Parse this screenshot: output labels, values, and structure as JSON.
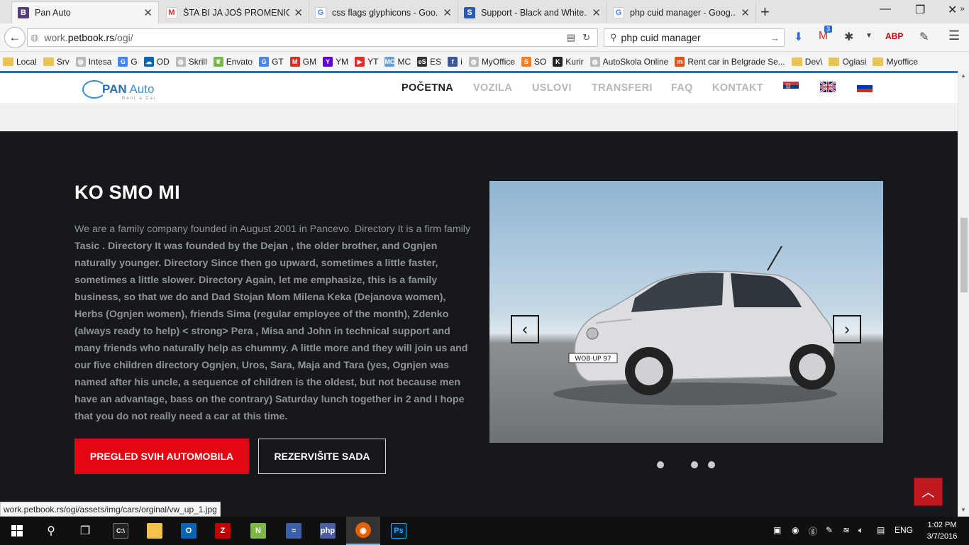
{
  "browser": {
    "tabs": [
      {
        "title": "Pan Auto",
        "favicon": "B",
        "favicon_color": "#563d7c",
        "active": true
      },
      {
        "title": "ŠTA BI JA JOŠ PROMENIO ...",
        "favicon": "M",
        "favicon_color": "#d93025",
        "active": false
      },
      {
        "title": "css flags glyphicons - Goo...",
        "favicon": "G",
        "favicon_color": "#4285f4",
        "active": false
      },
      {
        "title": "Support - Black and White...",
        "favicon": "S",
        "favicon_color": "#2a5bb0",
        "active": false
      },
      {
        "title": "php cuid manager - Goog...",
        "favicon": "G",
        "favicon_color": "#4285f4",
        "active": false
      }
    ],
    "new_tab": "+",
    "url_host": "work.",
    "url_domain": "petbook.rs",
    "url_path": "/ogi/",
    "search_value": "php cuid manager",
    "gmail_badge": "3",
    "bookmarks": [
      {
        "label": "Local",
        "icon": "folder"
      },
      {
        "label": "Srv",
        "icon": "folder"
      },
      {
        "label": "Intesa",
        "icon": "globe"
      },
      {
        "label": "G",
        "icon": "G"
      },
      {
        "label": "OD",
        "icon": "cloud"
      },
      {
        "label": "Skrill",
        "icon": "globe"
      },
      {
        "label": "Envato",
        "icon": "leaf"
      },
      {
        "label": "GT",
        "icon": "translate"
      },
      {
        "label": "GM",
        "icon": "M"
      },
      {
        "label": "YM",
        "icon": "Y"
      },
      {
        "label": "YT",
        "icon": "youtube"
      },
      {
        "label": "MC",
        "icon": "mc"
      },
      {
        "label": "ES",
        "icon": "es"
      },
      {
        "label": "i",
        "icon": "f"
      },
      {
        "label": "MyOffice",
        "icon": "globe"
      },
      {
        "label": "SO",
        "icon": "so"
      },
      {
        "label": "Kurir",
        "icon": "K"
      },
      {
        "label": "AutoSkola Online",
        "icon": "globe"
      },
      {
        "label": "Rent car in Belgrade Se...",
        "icon": "m"
      },
      {
        "label": "Dev\\",
        "icon": "folder"
      },
      {
        "label": "Oglasi",
        "icon": "folder"
      },
      {
        "label": "Myoffice",
        "icon": "folder"
      }
    ]
  },
  "site": {
    "logo_main": "PAN",
    "logo_accent": " Auto",
    "logo_sub": "Rent a Car",
    "menu": [
      "POČETNA",
      "VOZILA",
      "USLOVI",
      "TRANSFERI",
      "FAQ",
      "KONTAKT"
    ],
    "heading": "KO SMO MI",
    "paragraph_lead": "We are a family company founded in August 2001 in Pancevo. Directory It is a firm family ",
    "paragraph_bold": "Tasic . Directory It was founded by the Dejan , the older brother, and Ognjen naturally younger. Directory Since then go upward, sometimes a little faster, sometimes a little slower. Directory Again, let me emphasize, this is a family business, so that we do and Dad Stojan Mom Milena Keka (Dejanova women), Herbs (Ognjen women), friends Sima (regular employee of the month), Zdenko (always ready to help) < strong> Pera , Misa and John in technical support and many friends who naturally help as chummy. A little more and they will join us and our five children directory Ognjen, Uros, Sara, Maja and Tara (yes, Ognjen was named after his uncle, a sequence of children is the oldest, but not because men have an advantage, bass on the contrary) Saturday lunch together in 2 and I hope that you do not really need a car at this time.",
    "btn_all_cars": "PREGLED SVIH AUTOMOBILA",
    "btn_reserve": "REZERVIŠITE SADA",
    "plate": "WOB·UP 97",
    "carousel_slides": 3,
    "carousel_active": 1
  },
  "status_url": "work.petbook.rs/ogi/assets/img/cars/orginal/vw_up_1.jpg",
  "taskbar": {
    "language": "ENG",
    "time": "1:02 PM",
    "date": "3/7/2016"
  },
  "colors": {
    "accent_red": "#e30613",
    "page_dark": "#16181c",
    "header_blue": "#2a6eb6"
  }
}
